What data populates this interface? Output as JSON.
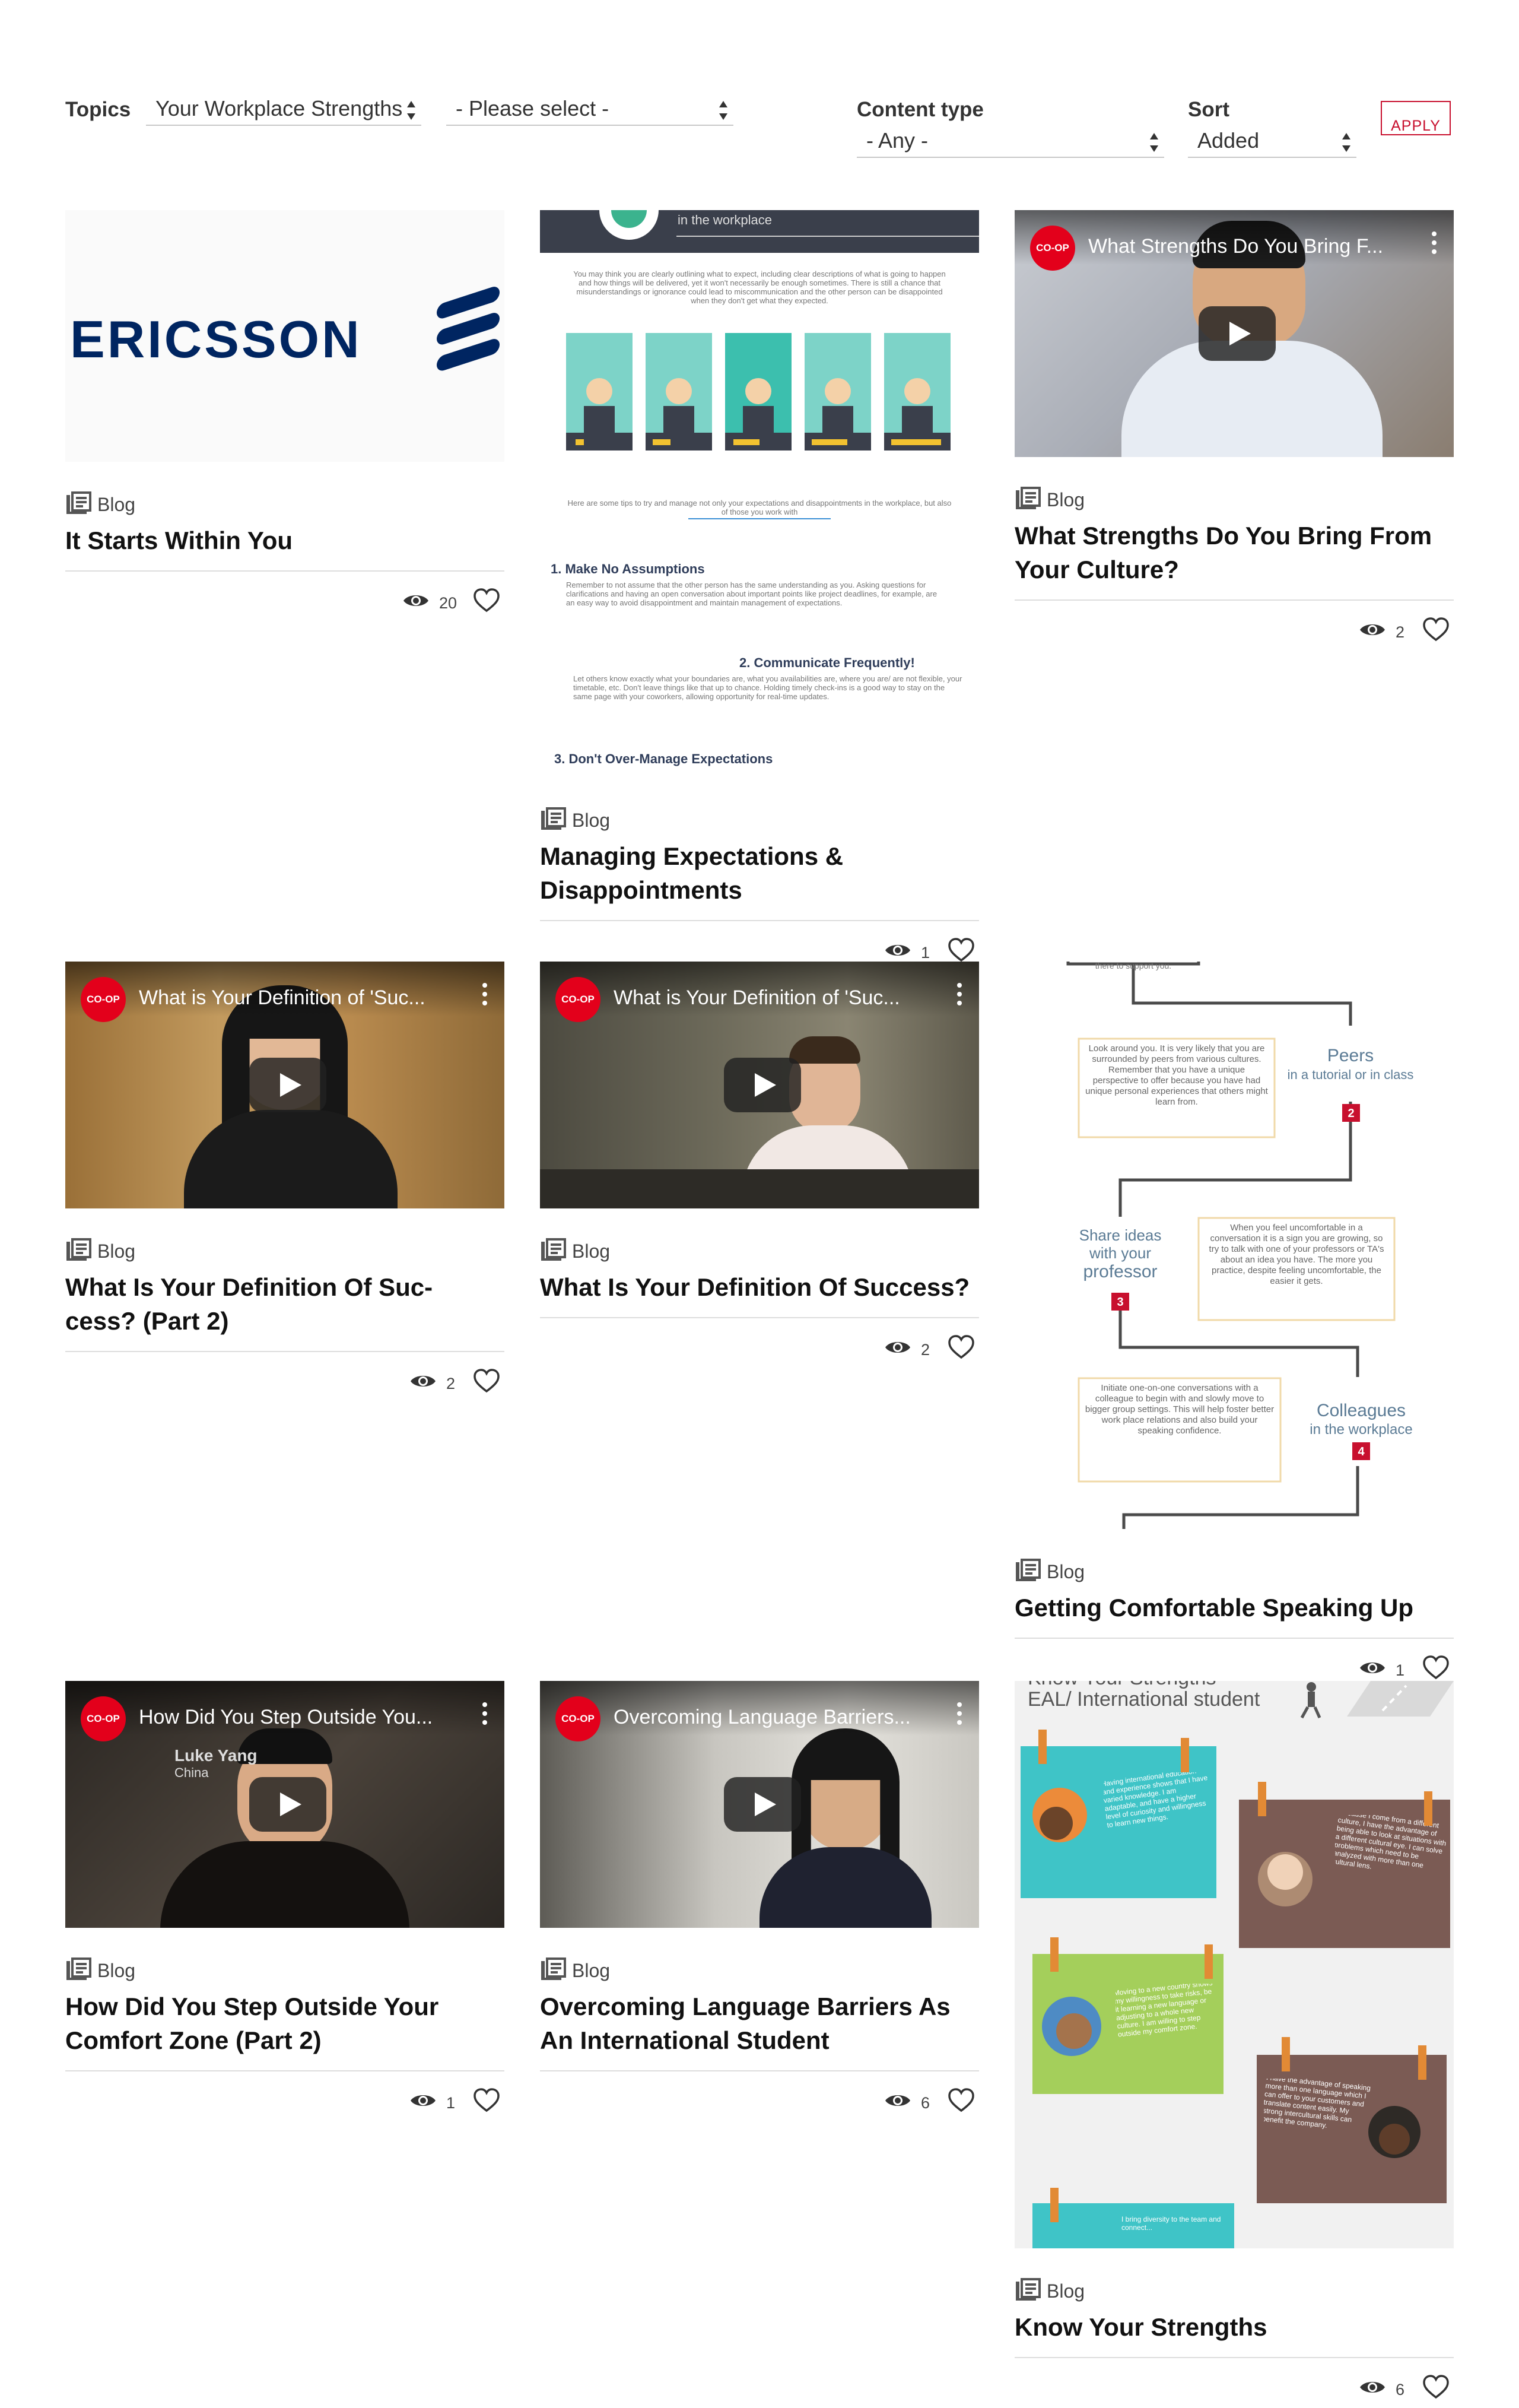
{
  "filters": {
    "topics_label": "Topics",
    "topic_value": "Your Workplace Strengths",
    "subtopic_value": "- Please select -",
    "content_type_label": "Content type",
    "content_type_value": "- Any -",
    "sort_label": "Sort",
    "sort_value": "Added",
    "apply_label": "APPLY"
  },
  "colors": {
    "brand_red": "#c8102e",
    "coop_red": "#e3001b",
    "ericsson_blue": "#002561"
  },
  "cards": [
    {
      "type": "Blog",
      "title": "It Starts Within You",
      "views": "20",
      "thumb": {
        "logo_text": "ERICSSON"
      }
    },
    {
      "type": "Blog",
      "title": "Managing Expectations & Disappointments",
      "views": "1",
      "thumb": {
        "header": "in the workplace",
        "intro": "You may think you are clearly outlining what to expect, including clear descriptions of what is going to happen and how things will be delivered, yet it won't necessarily be enough sometimes. There is still a chance that misunderstandings or ignorance could lead to miscommunication and the other person can be disappointed when they don't get what they expected.",
        "tips_intro": "Here are some tips to try and manage not only your expectations and disappointments in the workplace, but also of those you work with",
        "tip1_title": "1. Make No Assumptions",
        "tip1_text": "Remember to not assume that the other person has the same understanding as you. Asking questions for clarifications and having an open conversation about important points like project deadlines, for example, are an easy way to avoid disappointment and maintain management of expectations.",
        "tip2_title": "2. Communicate Frequently!",
        "tip2_text": "Let others know exactly what your boundaries are, what you availabilities are, where you are/ are not flexible, your timetable, etc. Don't leave things like that up to chance. Holding timely check-ins is a good way to stay on the same page with your coworkers, allowing opportunity for real-time updates.",
        "tip3_title": "3. Don't Over-Manage Expectations"
      }
    },
    {
      "type": "Blog",
      "title": "What Strengths Do You Bring From Your Culture?",
      "views": "2",
      "thumb": {
        "video_title": "What Strengths Do You Bring F...",
        "badge": "CO-OP"
      }
    },
    {
      "type": "Blog",
      "title": "What Is Your Definition Of Suc- cess? (Part 2)",
      "views": "2",
      "thumb": {
        "video_title": "What is Your Definition of 'Suc...",
        "badge": "CO-OP"
      }
    },
    {
      "type": "Blog",
      "title": "What Is Your Definition Of Success?",
      "views": "2",
      "thumb": {
        "video_title": "What is Your Definition of 'Suc...",
        "badge": "CO-OP"
      }
    },
    {
      "type": "Blog",
      "title": "Getting Comfortable Speaking Up",
      "views": "1",
      "thumb": {
        "top_text": "there to support you.",
        "peers_title": "Peers",
        "peers_sub": "in a tutorial or in class",
        "peers_num": "2",
        "peers_text": "Look around you. It is very likely that you are surrounded by peers from various cultures. Remember that you have a unique perspective to offer because you have had unique personal experiences that others might learn from.",
        "prof_title": "Share ideas with your professor",
        "prof_num": "3",
        "prof_text": "When you feel uncomfortable in a conversation it is a sign you are growing, so try to talk with one of your professors or TA's about an idea you have. The more you practice, despite feeling uncomfortable, the easier it gets.",
        "coll_title": "Colleagues",
        "coll_sub": "in the workplace",
        "coll_num": "4",
        "coll_text": "Initiate one-on-one conversations with a colleague to begin with and slowly move to bigger group settings. This will help foster better work place relations and also build your speaking confidence."
      }
    },
    {
      "type": "Blog",
      "title": "How Did You Step Outside Your Comfort Zone (Part 2)",
      "views": "1",
      "thumb": {
        "video_title": "How Did You Step Outside You...",
        "badge": "CO-OP",
        "name": "Luke Yang",
        "place": "China"
      }
    },
    {
      "type": "Blog",
      "title": "Overcoming Language Barriers As An International Student",
      "views": "6",
      "thumb": {
        "video_title": "Overcoming Language Barriers...",
        "badge": "CO-OP"
      }
    },
    {
      "type": "Blog",
      "title": "Know Your Strengths",
      "views": "6",
      "thumb": {
        "heading": "Know Your Strengths",
        "subheading": "EAL/ International student",
        "note1": "Having international education and experience shows that I have varied knowledge. I am adaptable, and have a higher level of curiosity and willingness to learn new things.",
        "note2": "Because I come from a different culture, I have the advantage of being able to look at situations with a different cultural eye. I can solve problems which need to be analyzed with more than one cultural lens.",
        "note3": "Moving to a new country shows my willingness to take risks, be it learning a new language or adjusting to a whole new culture. I am willing to step outside my comfort zone.",
        "note4": "I have the advantage of speaking more than one language which I can offer to your customers and translate content easily. My strong intercultural skills can benefit the company.",
        "note5": "I bring diversity to the team and connect..."
      }
    }
  ]
}
